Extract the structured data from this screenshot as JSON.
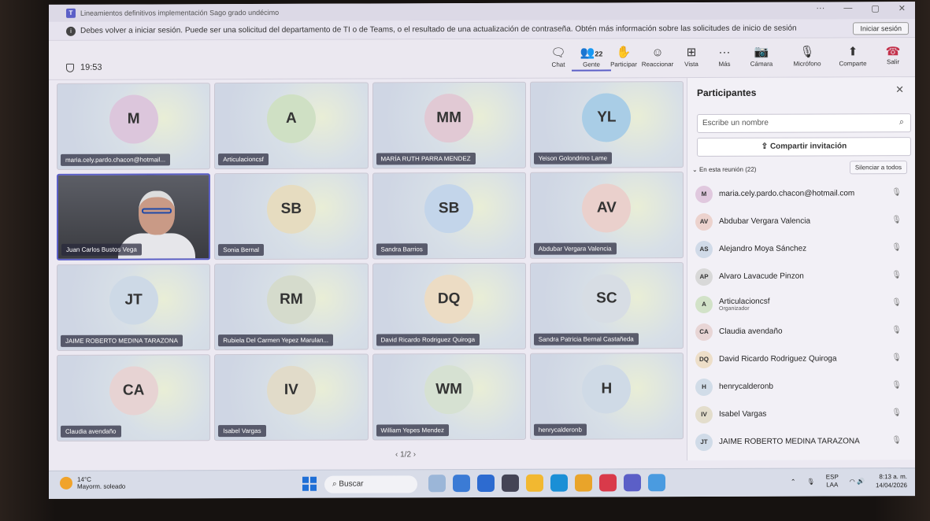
{
  "window": {
    "title": "Lineamientos definitivos implementación Sago grado undécimo"
  },
  "banner": {
    "text": "Debes volver a iniciar sesión. Puede ser una solicitud del departamento de TI o de Teams, o el resultado de una actualización de contraseña. Obtén más información sobre las solicitudes de inicio de sesión",
    "button": "Iniciar sesión"
  },
  "toolbar": {
    "timer": "19:53",
    "chat": "Chat",
    "people": "Gente",
    "people_count": "22",
    "raise": "Participar",
    "react": "Reaccionar",
    "view": "Vista",
    "more": "Más",
    "camera": "Cámara",
    "mic": "Micrófono",
    "share": "Comparte",
    "leave": "Salir"
  },
  "tiles": [
    {
      "initials": "M",
      "name": "maria.cely.pardo.chacon@hotmail...",
      "color": "#dcc6dc"
    },
    {
      "initials": "A",
      "name": "Articulacioncsf",
      "color": "#cfe0c4"
    },
    {
      "initials": "MM",
      "name": "MARÍA RUTH PARRA MENDEZ",
      "color": "#e1c9d4"
    },
    {
      "initials": "YL",
      "name": "Yeison Golondrino Lame",
      "color": "#a9cde6"
    },
    {
      "initials": "",
      "name": "Juan Carlos Bustos Vega",
      "color": ""
    },
    {
      "initials": "SB",
      "name": "Sonia Bernal",
      "color": "#e6dcc0"
    },
    {
      "initials": "SB",
      "name": "Sandra Barrios",
      "color": "#c3d5ea"
    },
    {
      "initials": "AV",
      "name": "Abdubar Vergara Valencia",
      "color": "#ead0cc"
    },
    {
      "initials": "JT",
      "name": "JAIME ROBERTO MEDINA TARAZONA",
      "color": "#cdd9e6"
    },
    {
      "initials": "RM",
      "name": "Rubiela Del Carmen Yepez Marulan...",
      "color": "#d5dbcc"
    },
    {
      "initials": "DQ",
      "name": "David Ricardo Rodriguez Quiroga",
      "color": "#ecdcc4"
    },
    {
      "initials": "SC",
      "name": "Sandra Patricia Bernal Castañeda",
      "color": "#d7dde4"
    },
    {
      "initials": "CA",
      "name": "Claudia avendaño",
      "color": "#e7d3d3"
    },
    {
      "initials": "IV",
      "name": "Isabel Vargas",
      "color": "#e1dbc9"
    },
    {
      "initials": "WM",
      "name": "William Yepes Mendez",
      "color": "#d6e1d2"
    },
    {
      "initials": "H",
      "name": "henrycalderonb",
      "color": "#cfdae6"
    }
  ],
  "pager": "1/2",
  "panel": {
    "title": "Participantes",
    "search_placeholder": "Escribe un nombre",
    "share_invite": "Compartir invitación",
    "section": "En esta reunión (22)",
    "mute_all": "Silenciar a todos",
    "participants": [
      {
        "initials": "M",
        "name": "maria.cely.pardo.chacon@hotmail.com",
        "role": "",
        "color": "#e0c8de"
      },
      {
        "initials": "AV",
        "name": "Abdubar Vergara Valencia",
        "role": "",
        "color": "#ecd2cd"
      },
      {
        "initials": "AS",
        "name": "Alejandro Moya Sánchez",
        "role": "",
        "color": "#d0dae8"
      },
      {
        "initials": "AP",
        "name": "Alvaro Lavacude Pinzon",
        "role": "",
        "color": "#d8d8d8"
      },
      {
        "initials": "A",
        "name": "Articulacioncsf",
        "role": "Organizador",
        "color": "#d2e2c8"
      },
      {
        "initials": "CA",
        "name": "Claudia avendaño",
        "role": "",
        "color": "#e8d5d5"
      },
      {
        "initials": "DQ",
        "name": "David Ricardo Rodriguez Quiroga",
        "role": "",
        "color": "#eddec8"
      },
      {
        "initials": "H",
        "name": "henrycalderonb",
        "role": "",
        "color": "#d1dce8"
      },
      {
        "initials": "IV",
        "name": "Isabel Vargas",
        "role": "",
        "color": "#e3ddcc"
      },
      {
        "initials": "JT",
        "name": "JAIME ROBERTO MEDINA TARAZONA",
        "role": "",
        "color": "#d0dbe8"
      }
    ]
  },
  "taskbar": {
    "temp": "14°C",
    "weather": "Mayorm. soleado",
    "search": "Buscar",
    "lang1": "ESP",
    "lang2": "LAA",
    "time": "8:13 a. m.",
    "date": "14/04/2026"
  }
}
